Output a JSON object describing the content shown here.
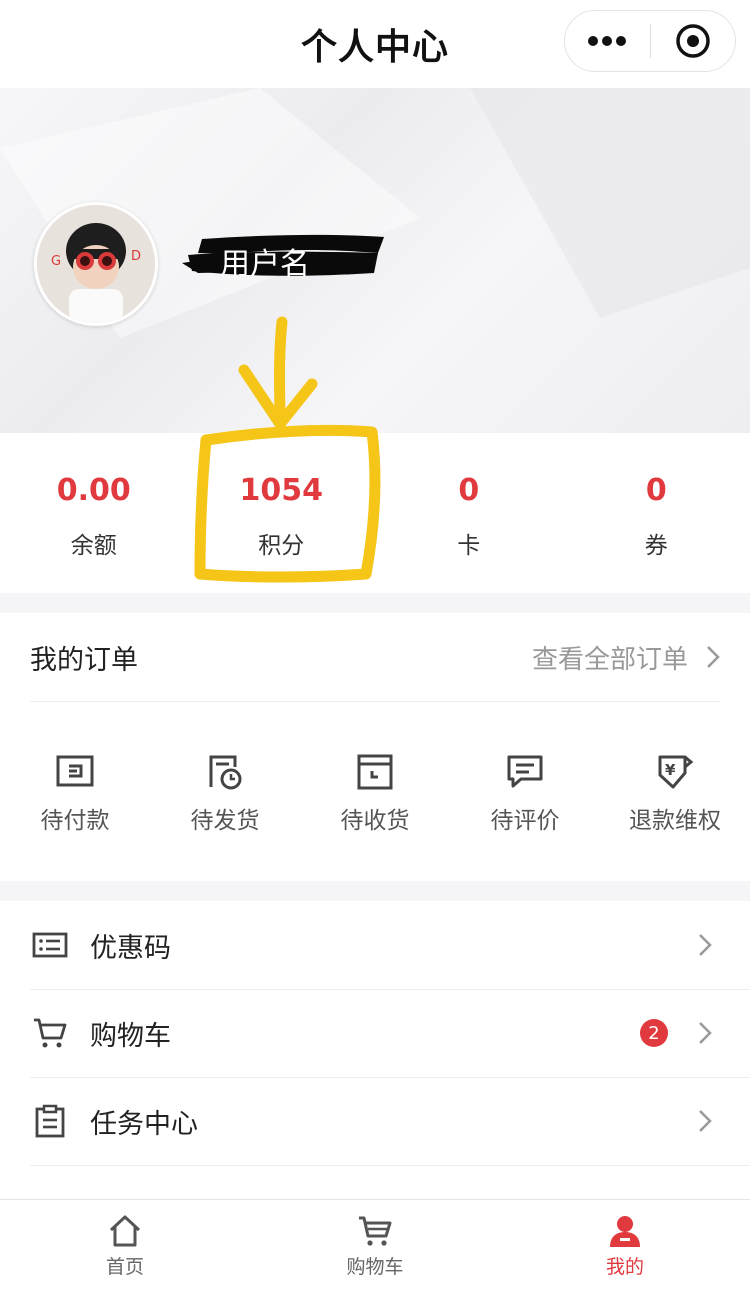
{
  "header": {
    "title": "个人中心"
  },
  "profile": {
    "username": "用户名"
  },
  "stats": [
    {
      "value": "0.00",
      "label": "余额"
    },
    {
      "value": "1054",
      "label": "积分"
    },
    {
      "value": "0",
      "label": "卡"
    },
    {
      "value": "0",
      "label": "券"
    }
  ],
  "orders": {
    "title": "我的订单",
    "view_all": "查看全部订单",
    "items": [
      {
        "label": "待付款",
        "icon": "wallet-icon"
      },
      {
        "label": "待发货",
        "icon": "clock-doc-icon"
      },
      {
        "label": "待收货",
        "icon": "box-icon"
      },
      {
        "label": "待评价",
        "icon": "comment-icon"
      },
      {
        "label": "退款维权",
        "icon": "refund-shield-icon"
      }
    ]
  },
  "menu": [
    {
      "label": "优惠码",
      "icon": "list-card-icon"
    },
    {
      "label": "购物车",
      "icon": "cart-icon",
      "badge": "2"
    },
    {
      "label": "任务中心",
      "icon": "clipboard-icon"
    }
  ],
  "tabbar": [
    {
      "label": "首页",
      "icon": "home-icon"
    },
    {
      "label": "购物车",
      "icon": "cart-icon"
    },
    {
      "label": "我的",
      "icon": "user-icon",
      "active": true
    }
  ],
  "colors": {
    "accent": "#e0393e",
    "annotation": "#f5c518"
  }
}
